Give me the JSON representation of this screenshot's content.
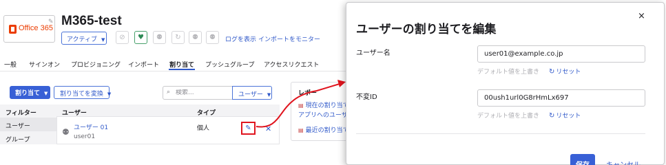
{
  "app": {
    "logo_text": "Office 365",
    "title": "M365-test",
    "status_label": "アクティブ",
    "links": [
      "ログを表示",
      "インポートをモニター"
    ],
    "action_icons": [
      "user-x-icon",
      "heart-icon",
      "user-icon",
      "refresh-icon",
      "user-icon",
      "user-icon"
    ]
  },
  "tabs": [
    {
      "label": "一般",
      "active": false
    },
    {
      "label": "サインオン",
      "active": false
    },
    {
      "label": "プロビジョニング",
      "active": false
    },
    {
      "label": "インポート",
      "active": false
    },
    {
      "label": "割り当て",
      "active": true
    },
    {
      "label": "プッシュグループ",
      "active": false
    },
    {
      "label": "アクセスリクエスト",
      "active": false
    }
  ],
  "toolbar": {
    "assign_label": "割り当て",
    "convert_label": "割り当てを変換",
    "search_placeholder": "検索...",
    "search_scope": "ユーザー"
  },
  "filters": {
    "header": "フィルター",
    "items": [
      "ユーザー",
      "グループ"
    ]
  },
  "table": {
    "columns": [
      "ユーザー",
      "タイプ"
    ],
    "rows": [
      {
        "name": "ユーザー 01",
        "username": "user01",
        "type": "個人"
      }
    ]
  },
  "report": {
    "title": "レポー",
    "links": [
      "現在の割り当て",
      "アプリへのユーザー",
      "最近の割り当て"
    ]
  },
  "modal": {
    "title": "ユーザーの割り当てを編集",
    "close": "×",
    "fields": [
      {
        "label": "ユーザー名",
        "value": "user01@example.co.jp",
        "hint": "デフォルト値を上書き",
        "reset": "リセット"
      },
      {
        "label": "不変ID",
        "value": "00ush1url0G8rHmLx697",
        "hint": "デフォルト値を上書き",
        "reset": "リセット"
      }
    ],
    "save_label": "保存",
    "cancel_label": "キャンセル"
  },
  "colors": {
    "accent": "#3860d6",
    "link": "#2f58c9",
    "highlight": "#e0141e",
    "office": "#eb3c00",
    "success": "#2e8a55"
  }
}
